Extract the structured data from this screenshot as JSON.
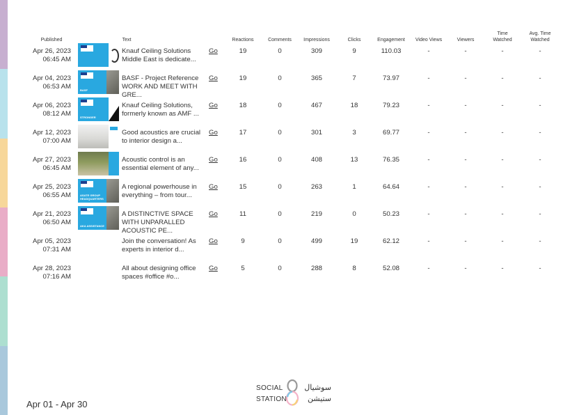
{
  "side_colors": [
    "#c7afd0",
    "#b8e2ec",
    "#f7d79a",
    "#e9adc7",
    "#addfd0",
    "#a9c8dc"
  ],
  "columns": {
    "published": "Published",
    "text": "Text",
    "reactions": "Reactions",
    "comments": "Comments",
    "impressions": "Impressions",
    "clicks": "Clicks",
    "engagement": "Engagement",
    "video_views": "Video Views",
    "viewers": "Viewers",
    "time_watched_1": "Time",
    "time_watched_2": "Watched",
    "avg_time_watched_1": "Avg. Time",
    "avg_time_watched_2": "Watched"
  },
  "rows": [
    {
      "date": "Apr 26, 2023",
      "time": "06:45 AM",
      "thumb": "blue-headset",
      "caption": "",
      "text": "Knauf Ceiling Solutions Middle East is dedicate...",
      "link": "Go",
      "reactions": "19",
      "comments": "0",
      "impressions": "309",
      "clicks": "9",
      "engagement": "110.03",
      "video_views": "-",
      "viewers": "-",
      "time_watched": "-",
      "avg_time_watched": "-"
    },
    {
      "date": "Apr 04, 2023",
      "time": "06:53 AM",
      "thumb": "blue-photo",
      "caption": "BASF",
      "text": "BASF - Project Reference WORK AND MEET WITH GRE...",
      "link": "Go",
      "reactions": "19",
      "comments": "0",
      "impressions": "365",
      "clicks": "7",
      "engagement": "73.97",
      "video_views": "-",
      "viewers": "-",
      "time_watched": "-",
      "avg_time_watched": "-"
    },
    {
      "date": "Apr 06, 2023",
      "time": "08:12 AM",
      "thumb": "blue-black",
      "caption": "STRONGER",
      "text": "Knauf Ceiling Solutions, formerly known as AMF ...",
      "link": "Go",
      "reactions": "18",
      "comments": "0",
      "impressions": "467",
      "clicks": "18",
      "engagement": "79.23",
      "video_views": "-",
      "viewers": "-",
      "time_watched": "-",
      "avg_time_watched": "-"
    },
    {
      "date": "Apr 12, 2023",
      "time": "07:00 AM",
      "thumb": "grey-interior",
      "caption": "",
      "text": "Good acoustics are crucial to interior design a...",
      "link": "Go",
      "reactions": "17",
      "comments": "0",
      "impressions": "301",
      "clicks": "3",
      "engagement": "69.77",
      "video_views": "-",
      "viewers": "-",
      "time_watched": "-",
      "avg_time_watched": "-"
    },
    {
      "date": "Apr 27, 2023",
      "time": "06:45 AM",
      "thumb": "green-interior",
      "caption": "",
      "text": "Acoustic control is an essential element of any...",
      "link": "Go",
      "reactions": "16",
      "comments": "0",
      "impressions": "408",
      "clicks": "13",
      "engagement": "76.35",
      "video_views": "-",
      "viewers": "-",
      "time_watched": "-",
      "avg_time_watched": "-"
    },
    {
      "date": "Apr 25, 2023",
      "time": "06:55 AM",
      "thumb": "blue-photo",
      "caption": "ASATE GROUP HEADQUARTERS",
      "text": "A regional powerhouse in everything – from tour...",
      "link": "Go",
      "reactions": "15",
      "comments": "0",
      "impressions": "263",
      "clicks": "1",
      "engagement": "64.64",
      "video_views": "-",
      "viewers": "-",
      "time_watched": "-",
      "avg_time_watched": "-"
    },
    {
      "date": "Apr 21, 2023",
      "time": "06:50 AM",
      "thumb": "blue-photo",
      "caption": "AKA ASSISTANCE",
      "text": "A DISTINCTIVE SPACE WITH UNPARALLED ACOUSTIC PE...",
      "link": "Go",
      "reactions": "11",
      "comments": "0",
      "impressions": "219",
      "clicks": "0",
      "engagement": "50.23",
      "video_views": "-",
      "viewers": "-",
      "time_watched": "-",
      "avg_time_watched": "-"
    },
    {
      "date": "Apr 05, 2023",
      "time": "07:31 AM",
      "thumb": "none",
      "caption": "",
      "text": "Join the conversation! As experts in interior d...",
      "link": "Go",
      "reactions": "9",
      "comments": "0",
      "impressions": "499",
      "clicks": "19",
      "engagement": "62.12",
      "video_views": "-",
      "viewers": "-",
      "time_watched": "-",
      "avg_time_watched": "-"
    },
    {
      "date": "Apr 28, 2023",
      "time": "07:16 AM",
      "thumb": "none",
      "caption": "",
      "text": "All about designing office spaces    #office #o...",
      "link": "Go",
      "reactions": "5",
      "comments": "0",
      "impressions": "288",
      "clicks": "8",
      "engagement": "52.08",
      "video_views": "-",
      "viewers": "-",
      "time_watched": "-",
      "avg_time_watched": "-"
    }
  ],
  "footer": {
    "date_range": "Apr 01 - Apr 30",
    "brand_en_1": "SOCIAL",
    "brand_en_2": "STATION",
    "brand_ar_1": "سوشيال",
    "brand_ar_2": "ستيشن"
  }
}
